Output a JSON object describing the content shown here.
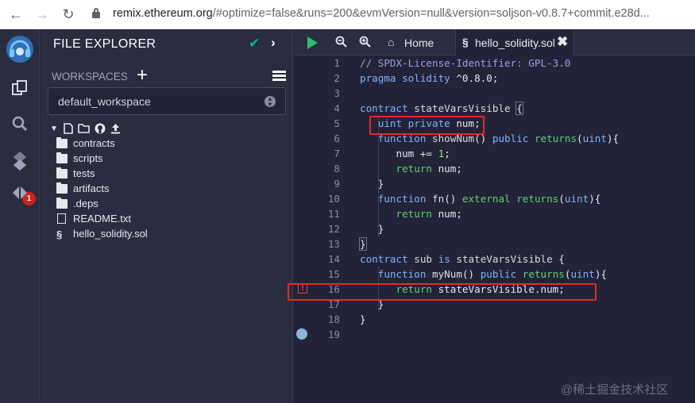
{
  "browser": {
    "url_host": "remix.ethereum.org",
    "url_rest": "/#optimize=false&runs=200&evmVersion=null&version=soljson-v0.8.7+commit.e28d..."
  },
  "rail": {
    "badge_count": "1"
  },
  "panel": {
    "title": "FILE EXPLORER",
    "workspaces_label": "WORKSPACES",
    "workspace_selected": "default_workspace",
    "tree": [
      {
        "type": "folder",
        "name": "contracts"
      },
      {
        "type": "folder",
        "name": "scripts"
      },
      {
        "type": "folder",
        "name": "tests"
      },
      {
        "type": "folder",
        "name": "artifacts"
      },
      {
        "type": "folder",
        "name": ".deps"
      },
      {
        "type": "file",
        "name": "README.txt"
      },
      {
        "type": "sol",
        "name": "hello_solidity.sol"
      }
    ]
  },
  "editor": {
    "tabs": [
      {
        "label": "Home"
      },
      {
        "label": "hello_solidity.sol"
      }
    ],
    "line_numbers": [
      "1",
      "2",
      "3",
      "4",
      "5",
      "6",
      "7",
      "8",
      "9",
      "10",
      "11",
      "12",
      "13",
      "14",
      "15",
      "16",
      "17",
      "18",
      "19"
    ]
  },
  "watermark": "@稀土掘金技术社区"
}
